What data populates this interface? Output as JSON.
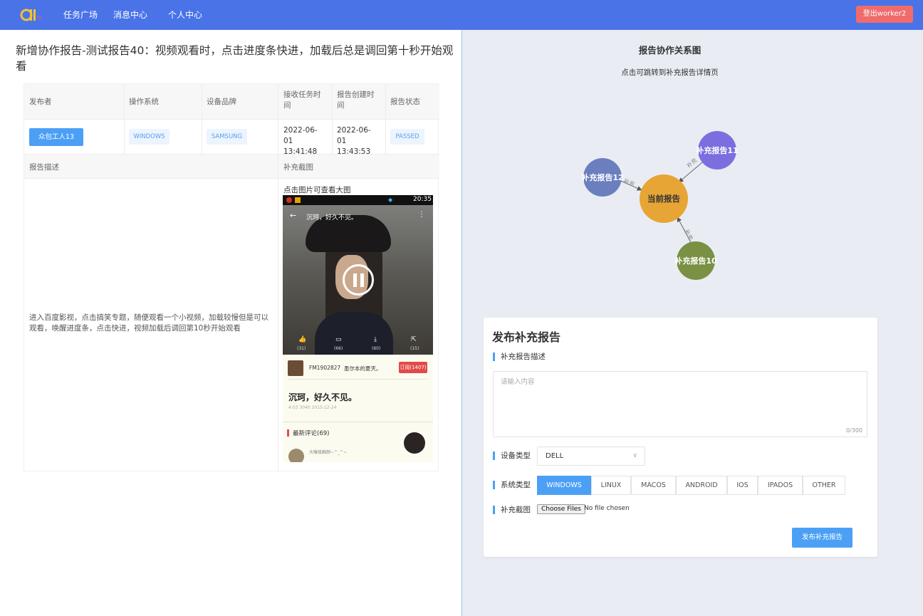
{
  "header": {
    "nav": [
      "任务广场",
      "消息中心",
      "个人中心"
    ],
    "logout_label": "登出worker2",
    "logo_color": "#f1c232"
  },
  "report": {
    "title": "新增协作报告-测试报告40：视频观看时，点击进度条快进，加载后总是调回第十秒开始观看",
    "columns": [
      "发布者",
      "操作系统",
      "设备品牌",
      "接收任务时间",
      "报告创建时间",
      "报告状态"
    ],
    "publisher": "众包工人13",
    "os": "WINDOWS",
    "brand": "SAMSUNG",
    "received_time": "2022-06-01 13:41:48",
    "created_time": "2022-06-01 13:43:53",
    "status": "PASSED",
    "desc_label": "报告描述",
    "shot_label": "补充截图",
    "shot_hint": "点击图片可查看大图",
    "description": "进入百度影视，点击搞笑专题，随便观看一个小视频，加载较慢但是可以观看，唤醒进度条，点击快进，视频加载后调回第10秒开始观看"
  },
  "phone": {
    "time": "20:35",
    "video_title": "沉珂，好久不见。",
    "actions": [
      "(31)",
      "(66)",
      "(60)",
      "(15)"
    ],
    "channel": "FM1902827",
    "channel_desc": "墨尔本的夏天。",
    "subscribe": "订阅(1407)",
    "headline": "沉珂，好久不见。",
    "meta": "4:03  3040  2015-12-24",
    "comments_label": "最新评论(69)",
    "commenter": "大曝接触颜~^_^~"
  },
  "graph": {
    "title": "报告协作关系图",
    "subtitle": "点击可跳转到补充报告详情页",
    "nodes": [
      {
        "id": "n-current",
        "label": "当前报告",
        "color": "#e6a535"
      },
      {
        "id": "n-11",
        "label": "补充报告11",
        "color": "#7b6fe0"
      },
      {
        "id": "n-12",
        "label": "补充报告12",
        "color": "#6b7fbf"
      },
      {
        "id": "n-10",
        "label": "补充报告10",
        "color": "#7a9043"
      }
    ],
    "edge_label": "补充"
  },
  "form": {
    "title": "发布补充报告",
    "desc_label": "补充报告描述",
    "desc_placeholder": "请输入内容",
    "counter": "0/300",
    "device_label": "设备类型",
    "device_value": "DELL",
    "system_label": "系统类型",
    "systems": [
      "WINDOWS",
      "LINUX",
      "MACOS",
      "ANDROID",
      "IOS",
      "IPADOS",
      "OTHER"
    ],
    "system_selected": "WINDOWS",
    "shot_label": "补充截图",
    "file_button": "Choose Files",
    "file_status": "No file chosen",
    "submit_label": "发布补充报告",
    "accent": "#4ba0f5"
  }
}
